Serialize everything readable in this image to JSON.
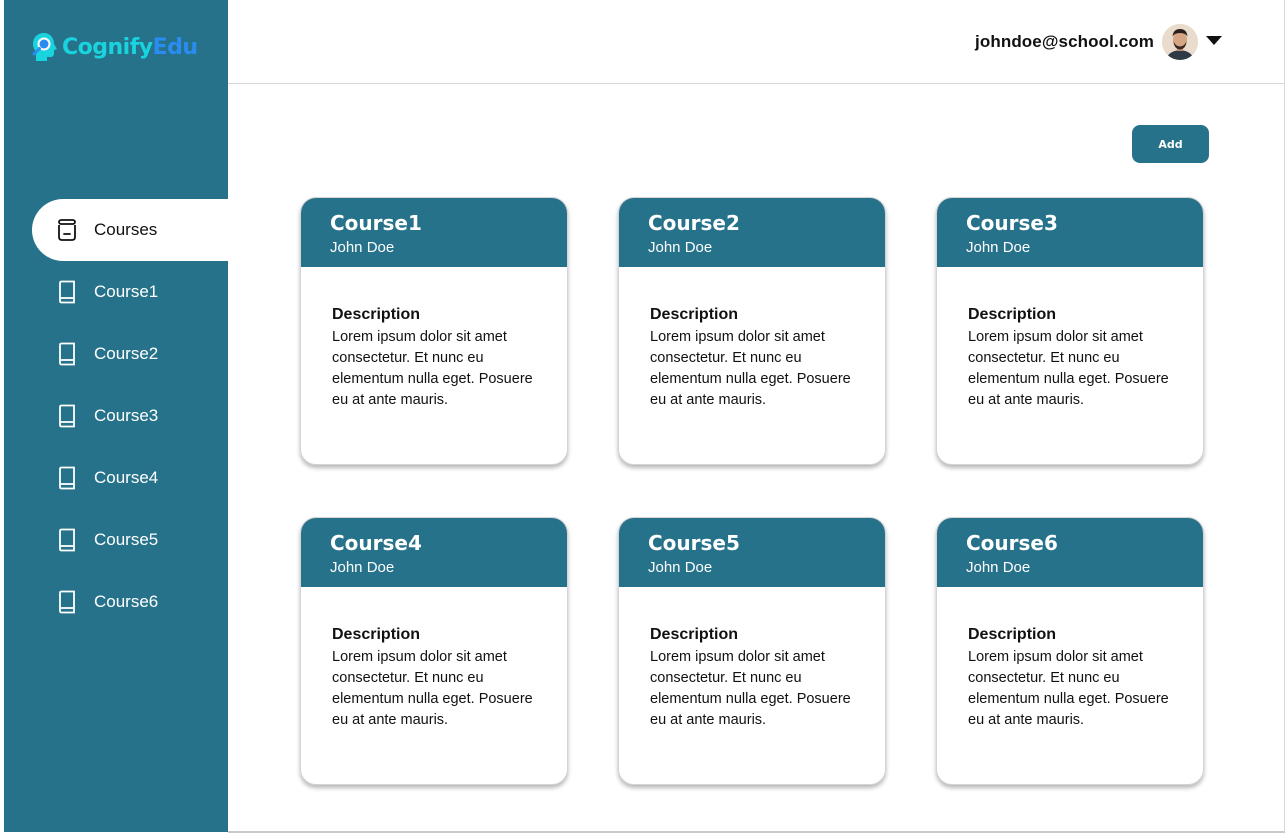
{
  "app": {
    "logo_part1": "Cognify",
    "logo_part2": "Edu"
  },
  "header": {
    "user_email": "johndoe@school.com"
  },
  "sidebar": {
    "items": [
      {
        "label": "Courses",
        "icon": "archive-jar-icon",
        "active": true
      },
      {
        "label": "Course1",
        "icon": "book-icon"
      },
      {
        "label": "Course2",
        "icon": "book-icon"
      },
      {
        "label": "Course3",
        "icon": "book-icon"
      },
      {
        "label": "Course4",
        "icon": "book-icon"
      },
      {
        "label": "Course5",
        "icon": "book-icon"
      },
      {
        "label": "Course6",
        "icon": "book-icon"
      }
    ]
  },
  "toolbar": {
    "add_label": "Add"
  },
  "courses": [
    {
      "title": "Course1",
      "author": "John Doe",
      "desc_label": "Description",
      "desc": "Lorem ipsum dolor sit amet consectetur. Et nunc eu elementum nulla eget. Posuere eu at ante mauris."
    },
    {
      "title": "Course2",
      "author": "John Doe",
      "desc_label": "Description",
      "desc": "Lorem ipsum dolor sit amet consectetur. Et nunc eu elementum nulla eget. Posuere eu at ante mauris."
    },
    {
      "title": "Course3",
      "author": "John Doe",
      "desc_label": "Description",
      "desc": "Lorem ipsum dolor sit amet consectetur. Et nunc eu elementum nulla eget. Posuere eu at ante mauris."
    },
    {
      "title": "Course4",
      "author": "John Doe",
      "desc_label": "Description",
      "desc": "Lorem ipsum dolor sit amet consectetur. Et nunc eu elementum nulla eget. Posuere eu at ante mauris."
    },
    {
      "title": "Course5",
      "author": "John Doe",
      "desc_label": "Description",
      "desc": "Lorem ipsum dolor sit amet consectetur. Et nunc eu elementum nulla eget. Posuere eu at ante mauris."
    },
    {
      "title": "Course6",
      "author": "John Doe",
      "desc_label": "Description",
      "desc": "Lorem ipsum dolor sit amet consectetur. Et nunc eu elementum nulla eget. Posuere eu at ante mauris."
    }
  ],
  "colors": {
    "primary": "#26728a",
    "logo_cyan": "#19d3df",
    "logo_blue": "#2a8cf0"
  }
}
